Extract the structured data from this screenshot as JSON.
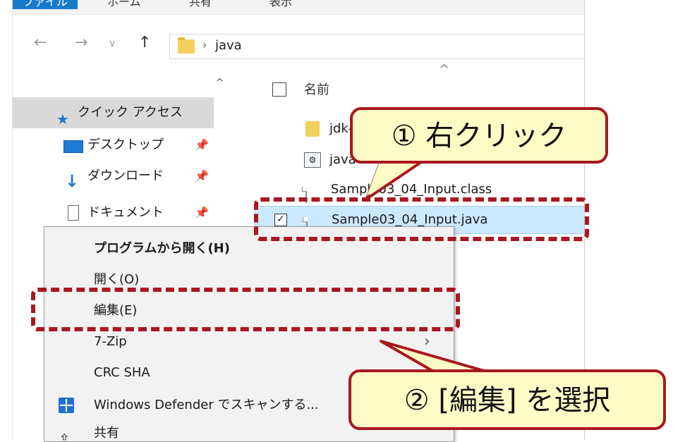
{
  "ribbon": {
    "tabs": [
      "ファイル",
      "ホーム",
      "共有",
      "表示"
    ]
  },
  "nav": {
    "back": "←",
    "forward": "→",
    "recent": "∨",
    "up": "↑"
  },
  "address": {
    "separator": "›",
    "path": "java"
  },
  "sidebar": {
    "scroll_up": "^",
    "items": [
      {
        "label": "クイック アクセス",
        "icon": "star-icon"
      },
      {
        "label": "デスクトップ",
        "icon": "desktop-icon",
        "pinned": true
      },
      {
        "label": "ダウンロード",
        "icon": "download-icon",
        "pinned": true
      },
      {
        "label": "ドキュメント",
        "icon": "document-icon",
        "pinned": true
      }
    ],
    "pin_glyph": "📌"
  },
  "files": {
    "sort_glyph": "^",
    "header": "名前",
    "items": [
      {
        "name": "jdk-",
        "icon": "folder-icon"
      },
      {
        "name": "java",
        "icon": "settings-file-icon"
      },
      {
        "name": "Sample03_04_Input.class",
        "icon": "file-icon"
      },
      {
        "name": "Sample03_04_Input.java",
        "icon": "file-icon",
        "selected": true,
        "checked": "✓"
      }
    ]
  },
  "context_menu": {
    "items": [
      {
        "label": "プログラムから開く(H)",
        "bold": true
      },
      {
        "label": "開く(O)"
      },
      {
        "label": "編集(E)"
      },
      {
        "label": "7-Zip",
        "submenu": "›"
      },
      {
        "label": "CRC SHA"
      },
      {
        "label": "Windows Defender でスキャンする...",
        "icon": "windows-defender-icon"
      },
      {
        "label": "共有",
        "icon": "share-icon"
      }
    ]
  },
  "annotations": {
    "step1": "① 右クリック",
    "step2": "② [編集] を選択",
    "color": "#a8181e",
    "fill": "#fdfbc6"
  }
}
